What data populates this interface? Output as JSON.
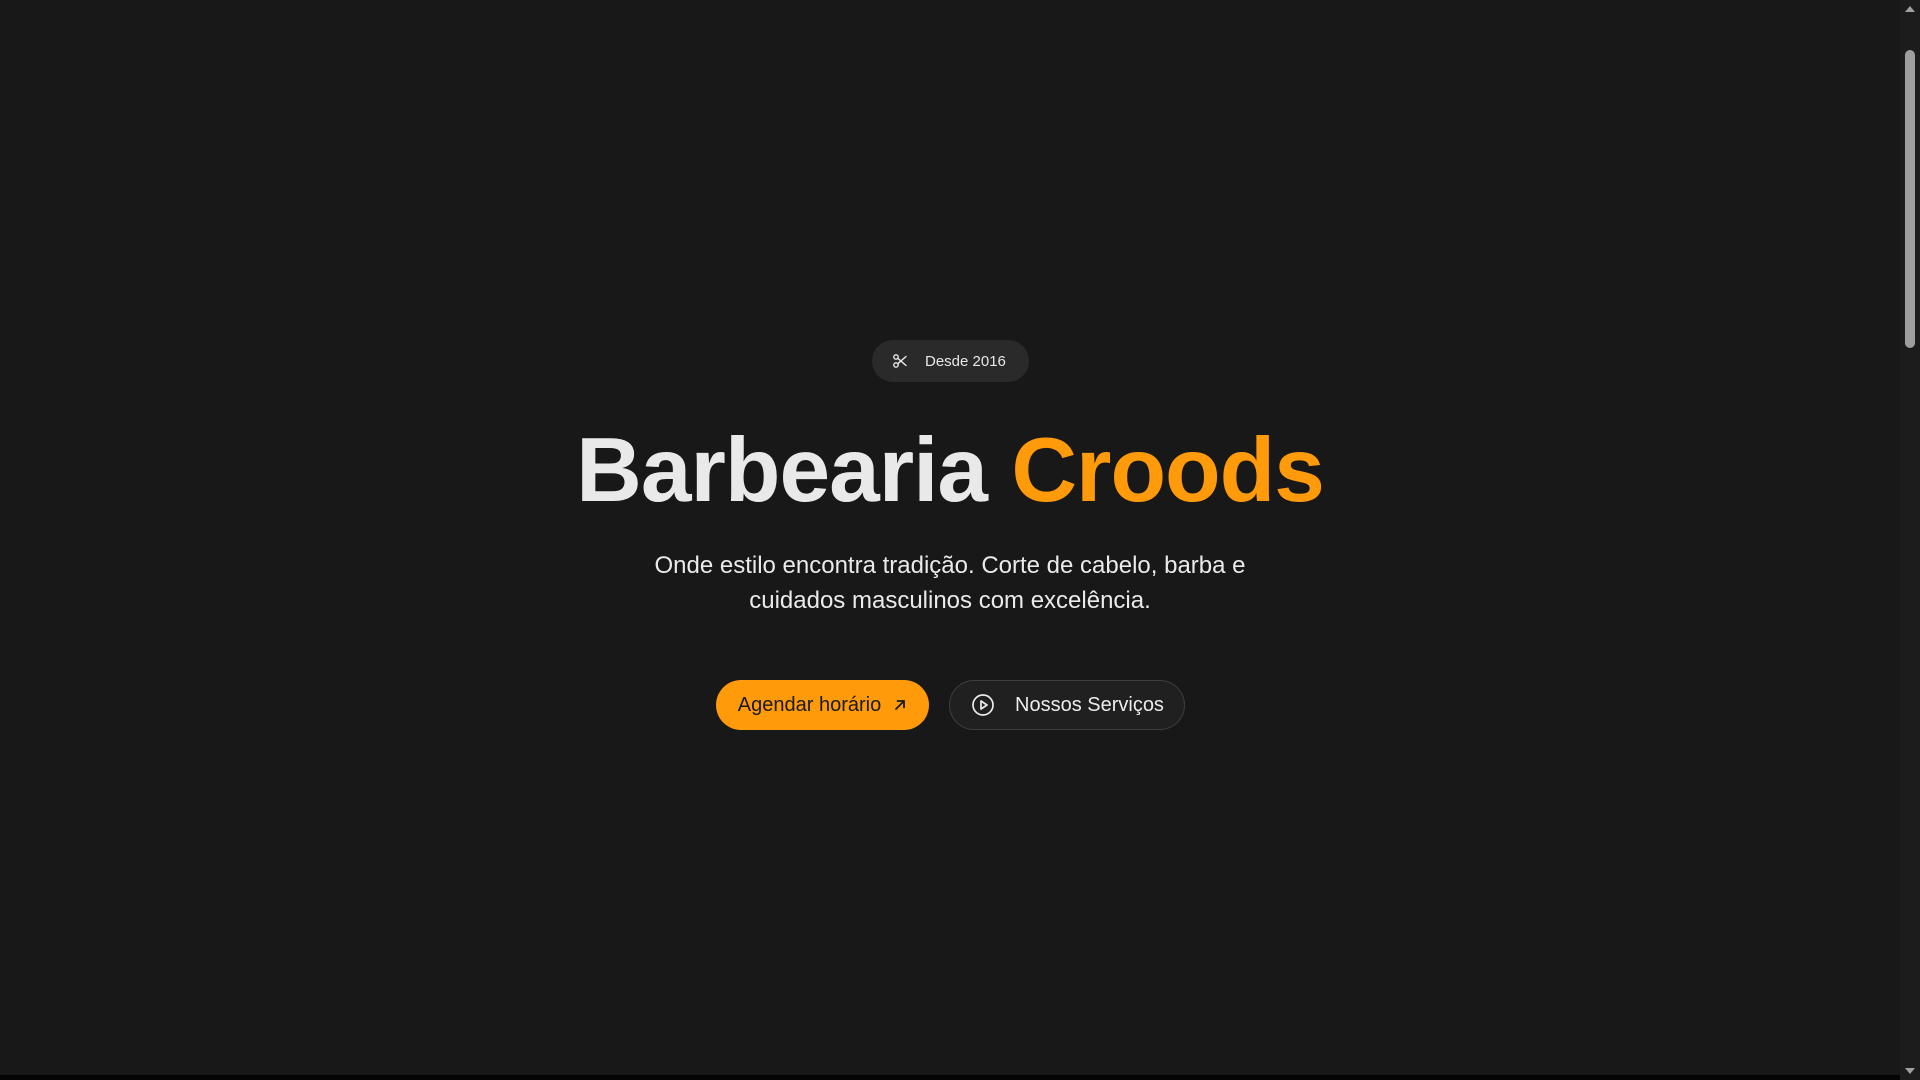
{
  "badge": {
    "icon": "scissors-icon",
    "text": "Desde 2016"
  },
  "hero": {
    "title_part1": "Barbearia",
    "title_part2": "Croods",
    "subtitle": "Onde estilo encontra tradição. Corte de cabelo, barba e cuidados masculinos com excelência."
  },
  "actions": {
    "primary_label": "Agendar horário",
    "primary_icon": "arrow-up-right-icon",
    "secondary_label": "Nossos Serviços",
    "secondary_icon": "play-circle-icon"
  },
  "colors": {
    "background": "#181818",
    "accent": "#ff9a0a",
    "text": "#eaeaea",
    "badge_bg": "#2a2a2a"
  }
}
